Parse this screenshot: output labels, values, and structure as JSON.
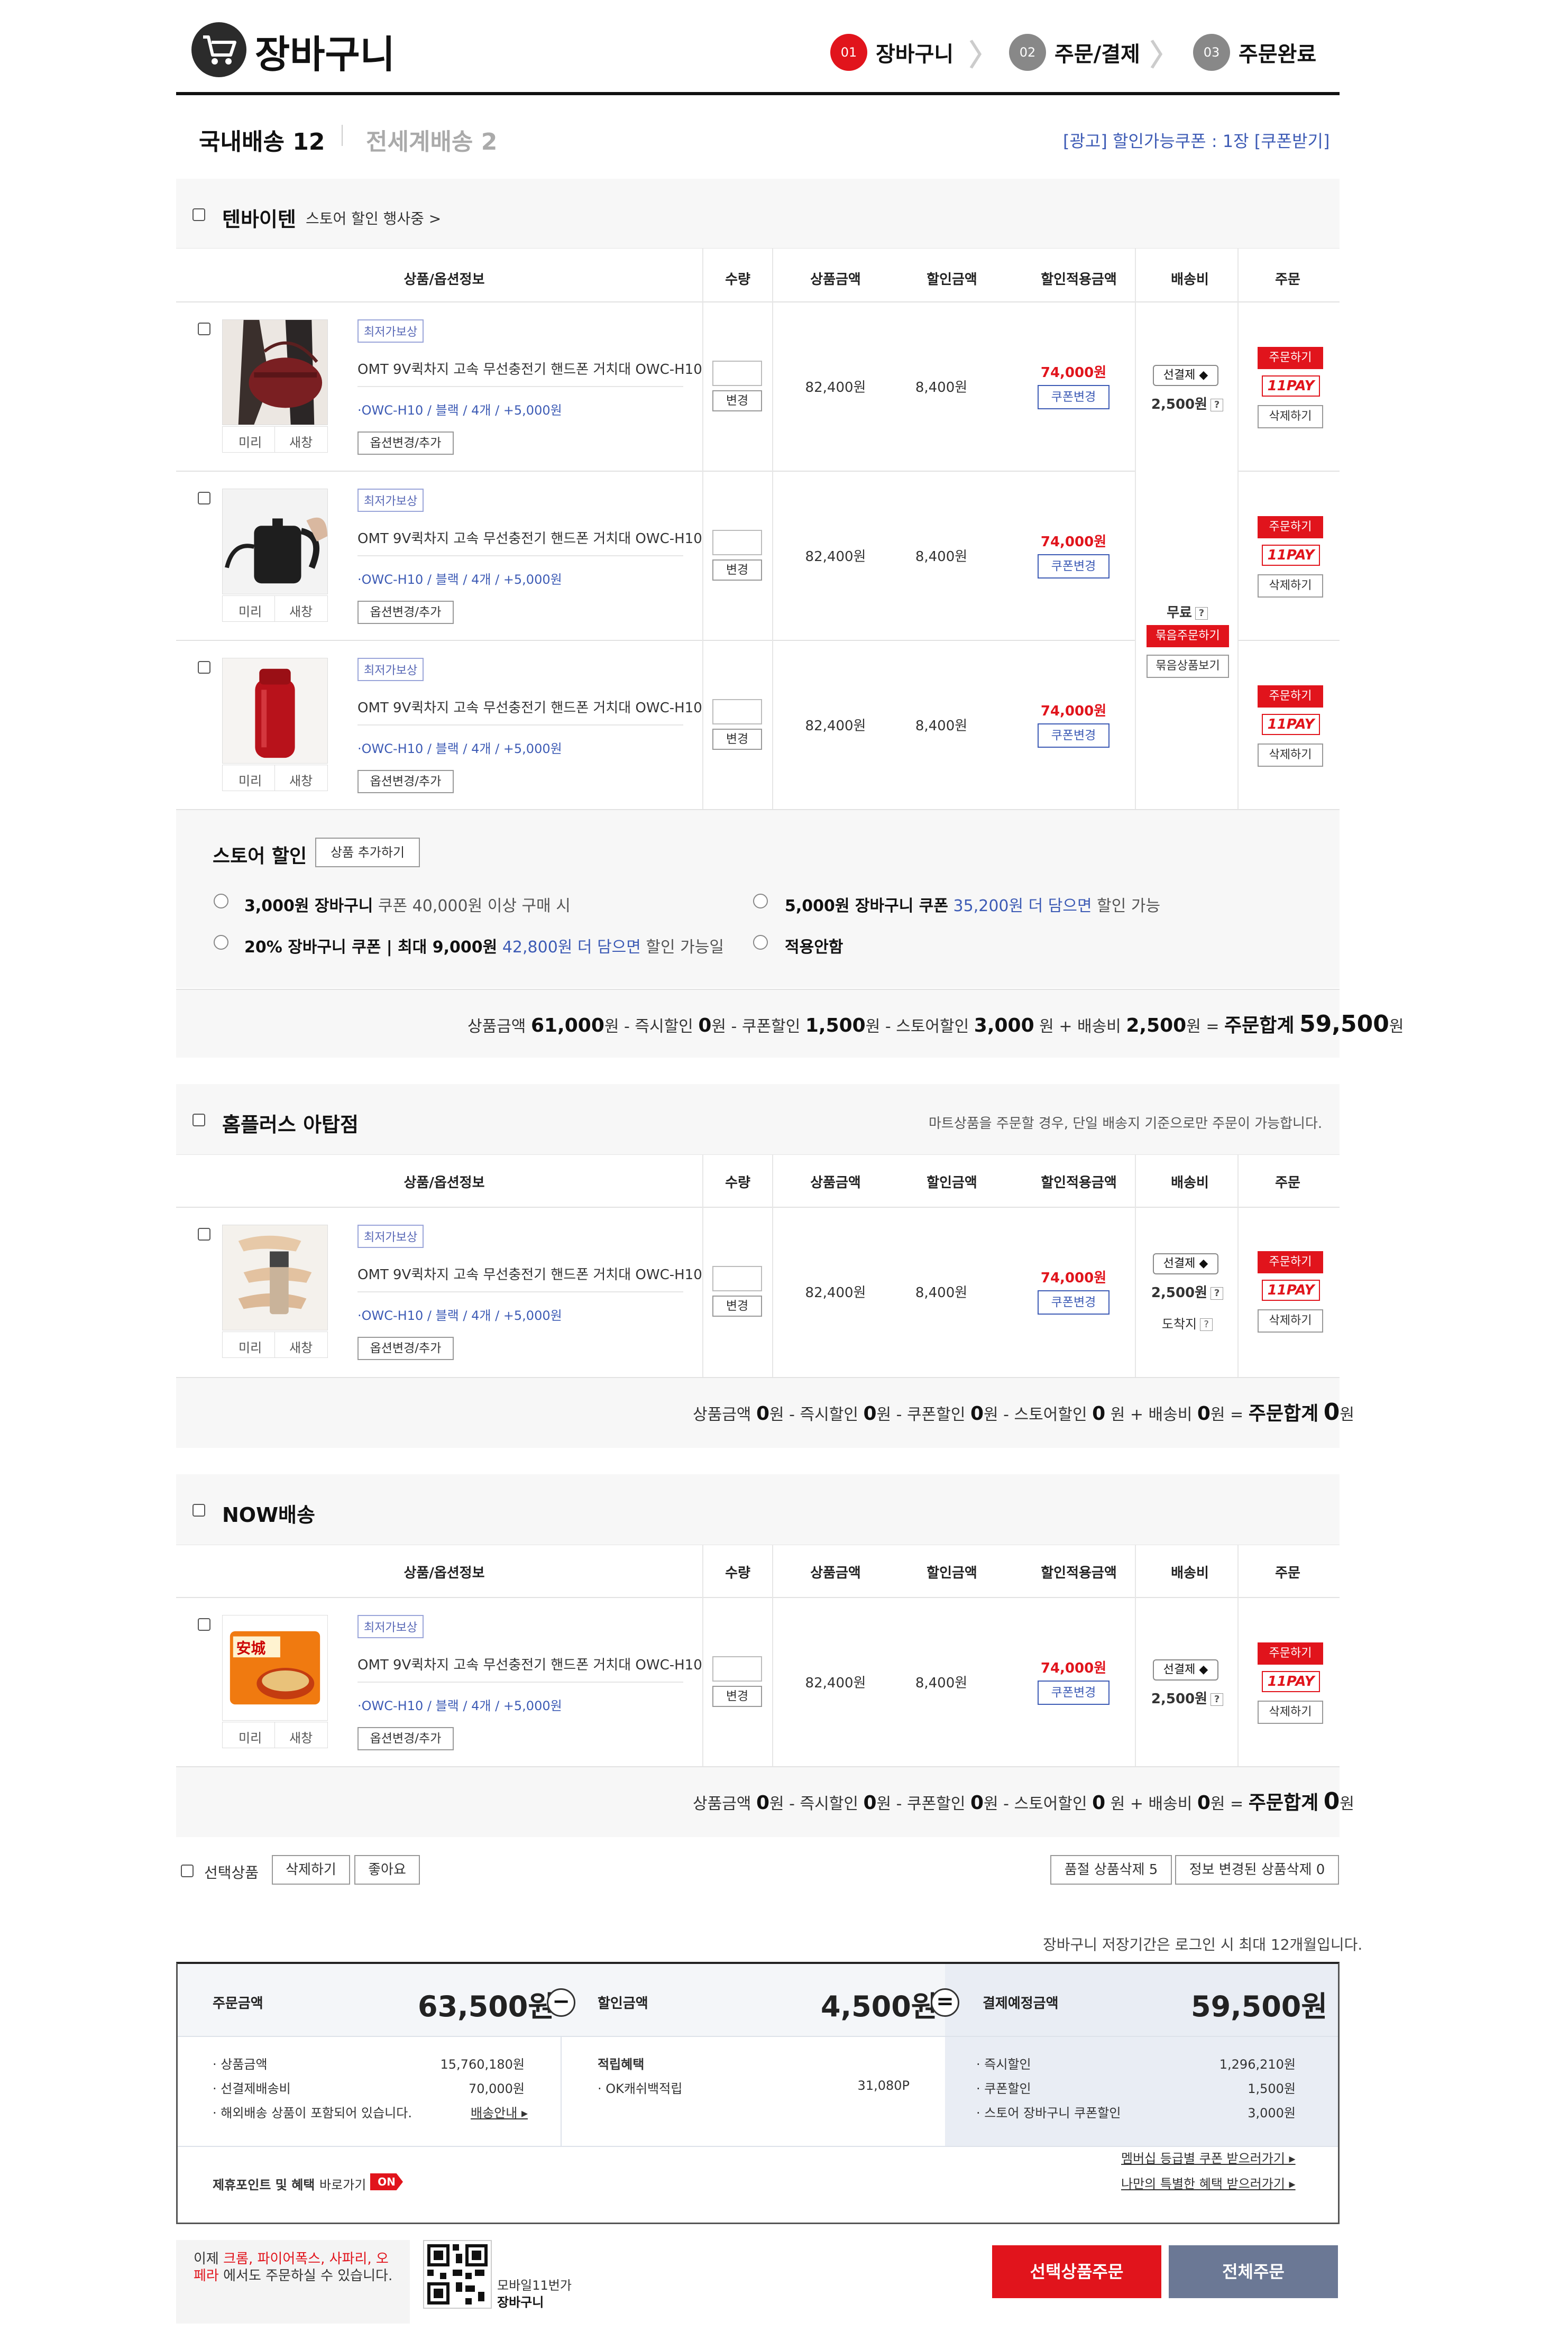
{
  "header": {
    "title": "장바구니",
    "steps": [
      {
        "num": "01",
        "label": "장바구니",
        "active": true
      },
      {
        "num": "02",
        "label": "주문/결제",
        "active": false
      },
      {
        "num": "03",
        "label": "주문완료",
        "active": false
      }
    ]
  },
  "tabs": {
    "domestic": "국내배송 12",
    "global": "전세계배송 2",
    "ad_coupon": "[광고] 할인가능쿠폰 : 1장 [쿠폰받기]"
  },
  "columns": [
    "상품/옵션정보",
    "수량",
    "상품금액",
    "할인금액",
    "할인적용금액",
    "배송비",
    "주문"
  ],
  "item_common": {
    "tag": "최저가보상",
    "name": "OMT 9V퀵차지 고속 무선충전기 핸드폰 거치대 OWC-H10",
    "option": "·OWC-H10 / 블랙 / 4개 / +5,000원",
    "option_btn": "옵션변경/추가",
    "qty_btn": "변경",
    "price": "82,400원",
    "discount": "8,400원",
    "final": "74,000원",
    "coupon_btn": "쿠폰변경",
    "mini": "미리",
    "newwin": "새창",
    "order": "주문하기",
    "pay": "11PAY",
    "delete": "삭제하기"
  },
  "shipping": {
    "select": "선결제 ◆",
    "fee": "2,500원",
    "free": "무료",
    "bundle_order": "묶음주문하기",
    "bundle_view": "묶음상품보기",
    "arrival": "도착지"
  },
  "store1": {
    "name": "텐바이텐",
    "promo": "스토어 할인 행사중  >",
    "discount_title": "스토어 할인",
    "add_btn": "상품 추가하기",
    "options": [
      {
        "bold": "3,000원 장바구니",
        "rest": " 쿠폰 40,000원 이상 구매 시",
        "blue": "",
        "tail": ""
      },
      {
        "bold": "5,000원 장바구니 쿠폰",
        "rest": "  ",
        "blue": "35,200원 더 담으면",
        "tail": " 할인 가능"
      },
      {
        "bold": "20% 장바구니 쿠폰 | 최대 9,000원",
        "rest": "  ",
        "blue": "42,800원 더 담으면",
        "tail": " 할인 가능일"
      },
      {
        "bold": "적용안함",
        "rest": "",
        "blue": "",
        "tail": ""
      }
    ],
    "summary": {
      "p1": "상품금액",
      "v1": "61,000",
      "p2": "원 - 즉시할인",
      "v2": "0",
      "p3": "원 - 쿠폰할인",
      "v3": "1,500",
      "p4": "원 - 스토어할인",
      "v4": "3,000",
      "p5": " 원 + 배송비",
      "v5": "2,500",
      "p6": "원 = ",
      "label": "주문합계",
      "total": "59,500",
      "unit": "원"
    }
  },
  "store2": {
    "name": "홈플러스 아탑점",
    "notice": "마트상품을 주문할 경우, 단일 배송지 기준으로만 주문이 가능합니다.",
    "summary": {
      "p1": "상품금액",
      "v1": "0",
      "p2": "원 - 즉시할인",
      "v2": "0",
      "p3": "원 - 쿠폰할인",
      "v3": "0",
      "p4": "원 - 스토어할인",
      "v4": "0",
      "p5": " 원 + 배송비",
      "v5": "0",
      "p6": "원 = ",
      "label": "주문합계",
      "total": "0",
      "unit": "원"
    }
  },
  "store3": {
    "name": "NOW배송",
    "summary": {
      "p1": "상품금액",
      "v1": "0",
      "p2": "원 - 즉시할인",
      "v2": "0",
      "p3": "원 - 쿠폰할인",
      "v3": "0",
      "p4": "원 - 스토어할인",
      "v4": "0",
      "p5": " 원 + 배송비",
      "v5": "0",
      "p6": "원 = ",
      "label": "주문합계",
      "total": "0",
      "unit": "원"
    }
  },
  "bulk": {
    "select": "선택상품",
    "delete": "삭제하기",
    "like": "좋아요",
    "soldout": "품절 상품삭제 5",
    "changed": "정보 변경된 상품삭제 0",
    "retention": "장바구니 저장기간은 로그인 시 최대 12개월입니다."
  },
  "totals": {
    "order_label": "주문금액",
    "order_value": "63,500원",
    "discount_label": "할인금액",
    "discount_value": "4,500원",
    "pay_label": "결제예정금액",
    "pay_value": "59,500원",
    "left": [
      {
        "label": "· 상품금액",
        "value": "15,760,180원"
      },
      {
        "label": "· 선결제배송비",
        "value": "70,000원"
      }
    ],
    "overseas": "· 해외배송 상품이 포함되어 있습니다.",
    "ship_guide": "배송안내 ▸",
    "reward_title": "적립혜택",
    "reward_label": "· OK캐쉬백적립",
    "reward_value": "31,080P",
    "right": [
      {
        "label": "· 즉시할인",
        "value": "1,296,210원"
      },
      {
        "label": "· 쿠폰할인",
        "value": "1,500원"
      },
      {
        "label": "· 스토어 장바구니 쿠폰할인",
        "value": "3,000원"
      }
    ],
    "partner": "제휴포인트 및 혜택",
    "partner_link": "바로가기",
    "on": "ON",
    "member_coupon": "멤버십 등급별 쿠폰 받으러가기 ▸",
    "special": "나만의 특별한 혜택 받으러가기 ▸"
  },
  "footer": {
    "browser_a": "이제 ",
    "browser_b": "크롬, 파이어폭스, 사파리, 오페라",
    "browser_c": " 에서도 주문하실 수 있습니다.",
    "mobile1": "모바일11번가",
    "mobile2": "장바구니",
    "order_selected": "선택상품주문",
    "order_all": "전체주문"
  },
  "colors": {
    "accent": "#e1141c",
    "blue": "#3d5bb5",
    "navy": "#6b7895"
  }
}
